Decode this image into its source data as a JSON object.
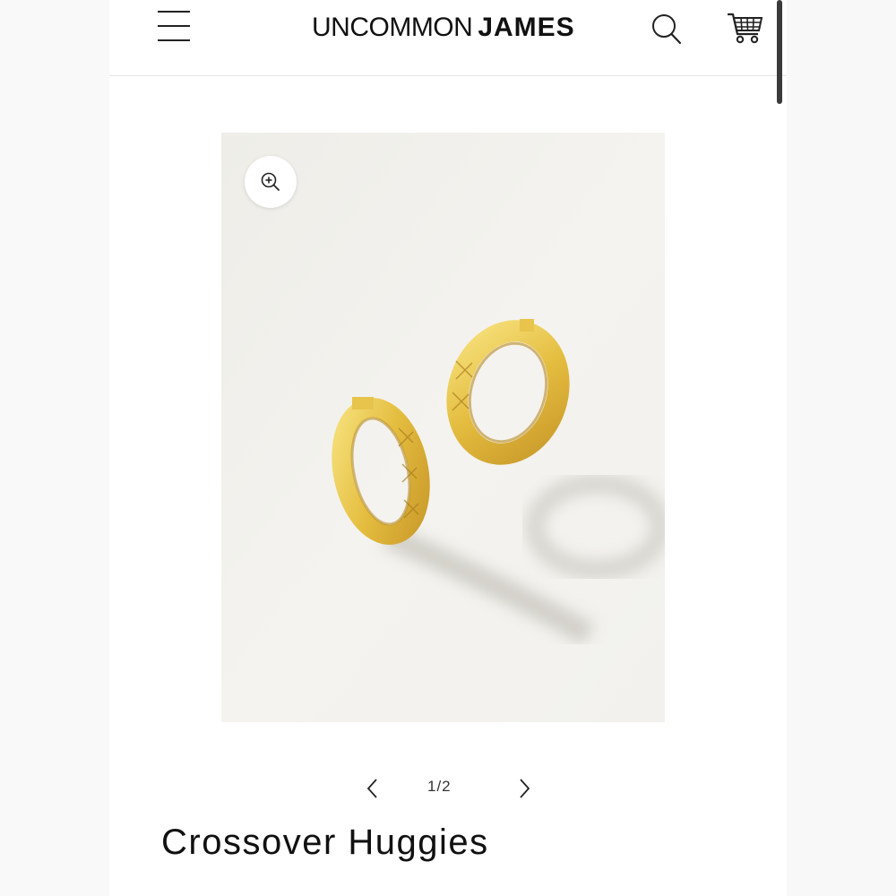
{
  "header": {
    "menu_icon": "hamburger-icon",
    "logo": {
      "light": "UNCOMMON",
      "bold": "JAMES"
    },
    "search_icon": "search-icon",
    "cart_icon": "cart-icon"
  },
  "gallery": {
    "zoom_icon": "zoom-in-icon",
    "image_subject": "gold quilted hoop huggie earrings",
    "current": "1/2",
    "prev_icon": "chevron-left-icon",
    "next_icon": "chevron-right-icon"
  },
  "product": {
    "title": "Crossover Huggies"
  },
  "colors": {
    "background": "#ffffff",
    "text": "#111111",
    "gold": "#e9c64e",
    "divider": "#e4e4e4"
  }
}
